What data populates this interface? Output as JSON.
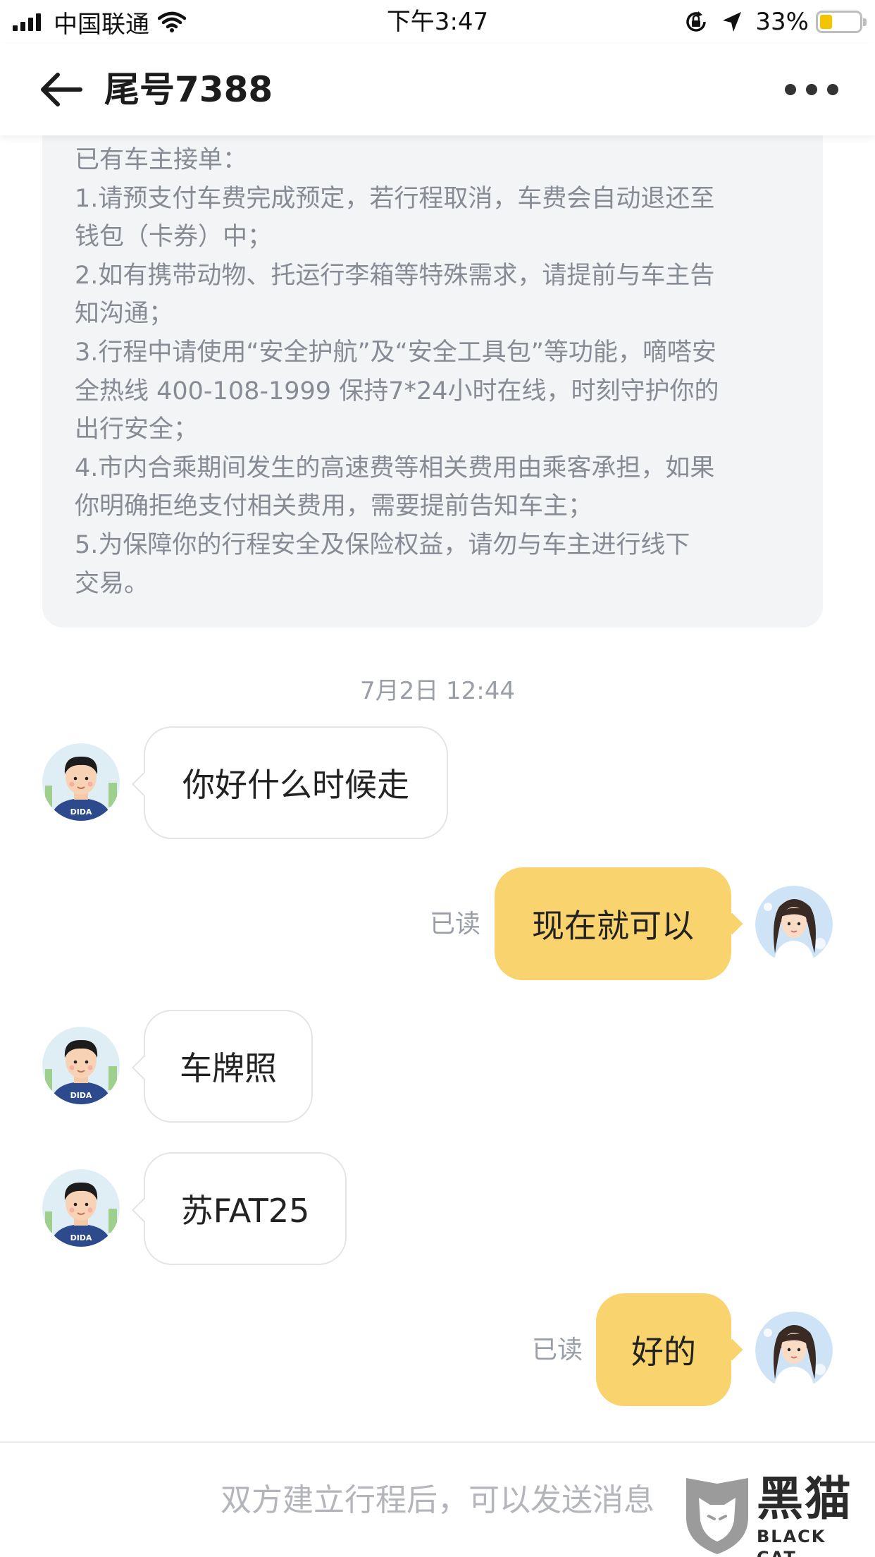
{
  "status_bar": {
    "carrier": "中国联通",
    "time": "下午3:47",
    "battery_percent": "33%",
    "battery_level": 0.33,
    "icons": [
      "signal-icon",
      "wifi-icon",
      "rotation-lock-icon",
      "location-arrow-icon",
      "battery-icon"
    ]
  },
  "nav": {
    "title": "尾号7388",
    "back_icon": "arrow-left-icon",
    "more_icon": "ellipsis-icon"
  },
  "notice": {
    "lines": [
      "已有车主接单：",
      "1.请预支付车费完成预定，若行程取消，车费会自动退还至",
      "钱包（卡券）中；",
      "2.如有携带动物、托运行李箱等特殊需求，请提前与车主告",
      "知沟通；",
      "3.行程中请使用“安全护航”及“安全工具包”等功能，嘀嗒安",
      "全热线  400-108-1999 保持7*24小时在线，时刻守护你的",
      "出行安全；",
      "4.市内合乘期间发生的高速费等相关费用由乘客承担，如果",
      "你明确拒绝支付相关费用，需要提前告知车主；",
      "5.为保障你的行程安全及保险权益，请勿与车主进行线下",
      "交易。"
    ]
  },
  "chat": {
    "timestamp": "7月2日 12:44",
    "messages": [
      {
        "direction": "incoming",
        "text": "你好什么时候走"
      },
      {
        "direction": "outgoing",
        "text": "现在就可以",
        "status": "已读"
      },
      {
        "direction": "incoming",
        "text": "车牌照"
      },
      {
        "direction": "incoming",
        "text": "苏FAT25"
      },
      {
        "direction": "outgoing",
        "text": "好的",
        "status": "已读"
      }
    ],
    "driver_avatar_badge": "DIDA"
  },
  "input": {
    "placeholder": "双方建立行程后，可以发送消息"
  },
  "watermark": {
    "title": "黑猫",
    "subtitle": "BLACK CAT"
  },
  "colors": {
    "outgoing_bubble": "#f9d46e",
    "incoming_bubble": "#ffffff",
    "notice_bg": "#f3f4f6",
    "battery": "#f5c400"
  }
}
